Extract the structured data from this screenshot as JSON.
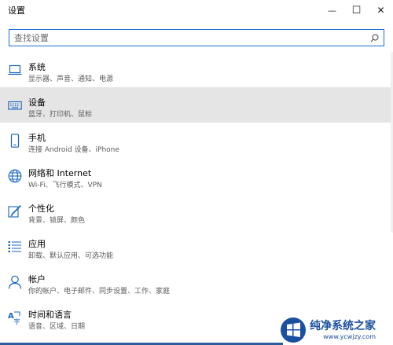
{
  "window": {
    "title": "设置",
    "controls": [
      "—",
      "☐",
      "✕"
    ]
  },
  "search": {
    "placeholder": "查找设置",
    "value": ""
  },
  "items": [
    {
      "icon": "laptop-icon",
      "label": "系统",
      "desc": "显示器、声音、通知、电源",
      "selected": false
    },
    {
      "icon": "keyboard-icon",
      "label": "设备",
      "desc": "蓝牙、打印机、鼠标",
      "selected": true
    },
    {
      "icon": "phone-icon",
      "label": "手机",
      "desc": "连接 Android 设备、iPhone",
      "selected": false
    },
    {
      "icon": "globe-icon",
      "label": "网络和 Internet",
      "desc": "Wi-Fi、飞行模式、VPN",
      "selected": false
    },
    {
      "icon": "paintbrush-icon",
      "label": "个性化",
      "desc": "背景、锁屏、颜色",
      "selected": false
    },
    {
      "icon": "apps-list-icon",
      "label": "应用",
      "desc": "卸载、默认应用、可选功能",
      "selected": false
    },
    {
      "icon": "person-icon",
      "label": "帐户",
      "desc": "你的帐户、电子邮件、同步设置、工作、家庭",
      "selected": false
    },
    {
      "icon": "language-icon",
      "label": "时间和语言",
      "desc": "语音、区域、日期",
      "selected": false
    }
  ],
  "watermark": {
    "main": "纯净系统之家",
    "url": "www.ycwjzy.com"
  },
  "colors": {
    "accent": "#1a6fd4",
    "selected_bg": "#e5e5e5",
    "icon": "#1565c0"
  }
}
